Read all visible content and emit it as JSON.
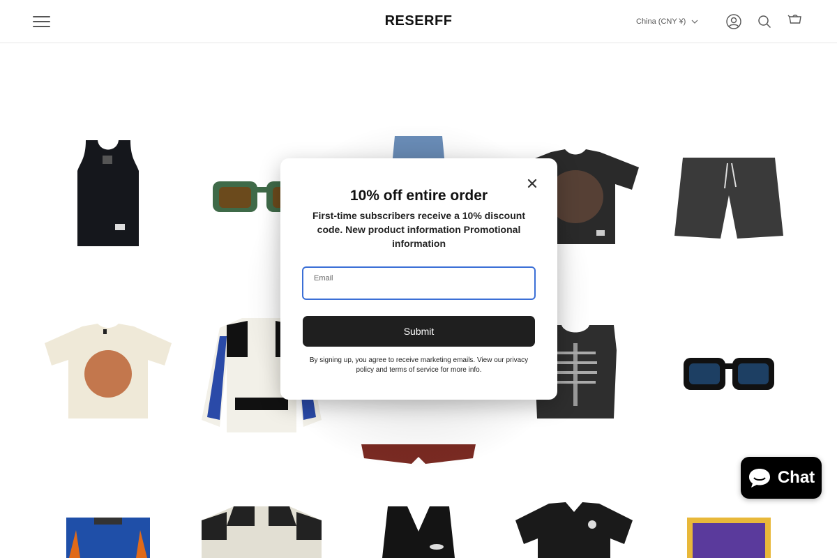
{
  "header": {
    "logo": "RESERFF",
    "currency": "China (CNY ¥)",
    "icons": [
      "menu-icon",
      "account-icon",
      "search-icon",
      "cart-icon"
    ]
  },
  "products": [
    {
      "name": "black-tank-top",
      "color": "#15171c"
    },
    {
      "name": "green-sunglasses",
      "color": "#3f6a48"
    },
    {
      "name": "denim-shorts",
      "color": "#6a8db8"
    },
    {
      "name": "graphic-print-tee",
      "color": "#2a2a2a"
    },
    {
      "name": "grey-washed-shorts",
      "color": "#3a3a3a"
    },
    {
      "name": "cream-graphic-tee",
      "color": "#efe9d8"
    },
    {
      "name": "racing-jacket",
      "color": "#111111"
    },
    {
      "name": "red-paisley-shorts",
      "color": "#7a2a22"
    },
    {
      "name": "skeleton-vest",
      "color": "#2e2e2e"
    },
    {
      "name": "black-sunglasses",
      "color": "#111111"
    },
    {
      "name": "blue-muay-thai-shorts",
      "color": "#1f4fa8"
    },
    {
      "name": "black-cream-jersey",
      "color": "#e2dfd3"
    },
    {
      "name": "leather-vest",
      "color": "#141414"
    },
    {
      "name": "black-shirt",
      "color": "#1a1a1a"
    },
    {
      "name": "purple-basketball-shorts",
      "color": "#5a3a9c"
    }
  ],
  "popup": {
    "title": "10% off entire order",
    "subtitle": "First-time subscribers receive a 10% discount code. New product information Promotional information",
    "email_label": "Email",
    "email_value": "",
    "submit_label": "Submit",
    "legal": "By signing up, you agree to receive marketing emails. View our privacy policy and terms of service for more info."
  },
  "chat": {
    "label": "Chat"
  },
  "colors": {
    "accent_input_border": "#3b6fd6",
    "button_dark": "#1f1f1f",
    "chat_bg": "#000000"
  }
}
